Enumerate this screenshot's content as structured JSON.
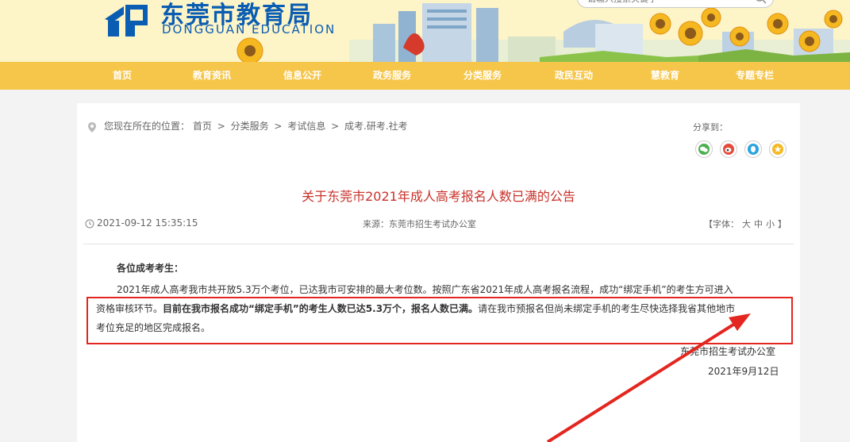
{
  "header": {
    "site_name": "东莞市教育局",
    "site_name_en": "DONGGUAN EDUCATION",
    "search_placeholder": "请输入搜索关键字"
  },
  "nav": {
    "items": [
      "首页",
      "教育资讯",
      "信息公开",
      "政务服务",
      "分类服务",
      "政民互动",
      "慧教育",
      "专题专栏"
    ]
  },
  "breadcrumb": {
    "prefix": "您现在所在的位置：",
    "items": [
      "首页",
      "分类服务",
      "考试信息",
      "成考.研考.社考"
    ],
    "separator": ">"
  },
  "share": {
    "label": "分享到：",
    "channels": [
      "wechat",
      "weibo",
      "qq",
      "favorite"
    ]
  },
  "article": {
    "title": "关于东莞市2021年成人高考报名人数已满的公告",
    "publish_date": "2021-09-12 15:35:15",
    "source": "来源：东莞市招生考试办公室",
    "font_size": {
      "prefix": "【字体：",
      "large": "大",
      "medium": "中",
      "small": "小",
      "suffix": "】"
    },
    "salutation": "各位成考考生：",
    "line1": "2021年成人高考我市共开放5.3万个考位，已达我市可安排的最大考位数。按照广东省2021年成人高考报名流程，成功“绑定手机”的考生方可进入",
    "line2_normal": "资格审核环节。",
    "line2_bold": "目前在我市报名成功“绑定手机”的考生人数已达5.3万个，报名人数已满。",
    "line2_tail": "请在我市预报名但尚未绑定手机的考生尽快选择我省其他地市",
    "line3": "考位充足的地区完成报名。",
    "signature": "东莞市招生考试办公室",
    "sign_date": "2021年9月12日"
  },
  "colors": {
    "nav_bg": "#f6c64a",
    "title_red": "#c8312a",
    "brand_blue": "#0a5db2",
    "annotation_red": "#e3261f"
  }
}
